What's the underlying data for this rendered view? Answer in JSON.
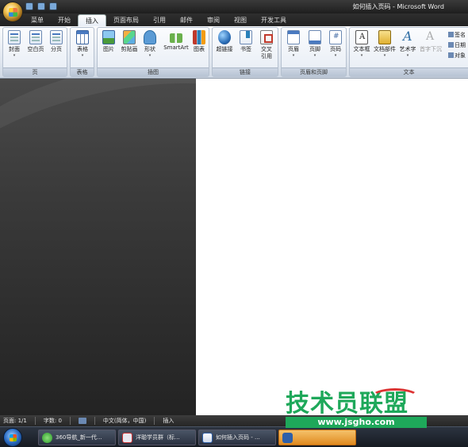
{
  "titlebar": {
    "document_name": "如何插入页码",
    "separator": " - ",
    "app_name": "Microsoft Word"
  },
  "tabs": [
    "菜单",
    "开始",
    "插入",
    "页面布局",
    "引用",
    "邮件",
    "审阅",
    "视图",
    "开发工具"
  ],
  "active_tab": "插入",
  "ribbon": {
    "groups": {
      "pages": "页",
      "tables": "表格",
      "illustrations": "插图",
      "links": "链接",
      "header_footer": "页眉和页脚",
      "text": "文本"
    },
    "buttons": {
      "cover": "封面",
      "blank_page": "空白页",
      "page_break": "分页",
      "table": "表格",
      "picture": "图片",
      "clip_art": "剪贴画",
      "shapes": "形状",
      "smartart": "SmartArt",
      "chart": "图表",
      "hyperlink": "超链接",
      "bookmark": "书签",
      "cross_ref_1": "交叉",
      "cross_ref_2": "引用",
      "header": "页眉",
      "footer": "页脚",
      "page_number": "页码",
      "text_box": "文本框",
      "doc_parts": "文档部件",
      "wordart": "艺术字",
      "drop_cap": "首字下沉",
      "signature": "签名",
      "datetime": "日期",
      "object": "对象"
    }
  },
  "statusbar": {
    "page": "页面: 1/1",
    "words": "字数: 0",
    "language": "中文(简体，中国)",
    "mode": "插入"
  },
  "taskbar": {
    "items": [
      "360导航_新一代...",
      "洋聪学员群（标...",
      "如何插入页码 - ..."
    ]
  },
  "watermark": {
    "brand": "技术员联盟",
    "url": "www.jsgho.com"
  },
  "colors": {
    "accent": "#1ea85a",
    "document_bg": "#ffffff",
    "workspace_bg": "#3a3a3a"
  }
}
